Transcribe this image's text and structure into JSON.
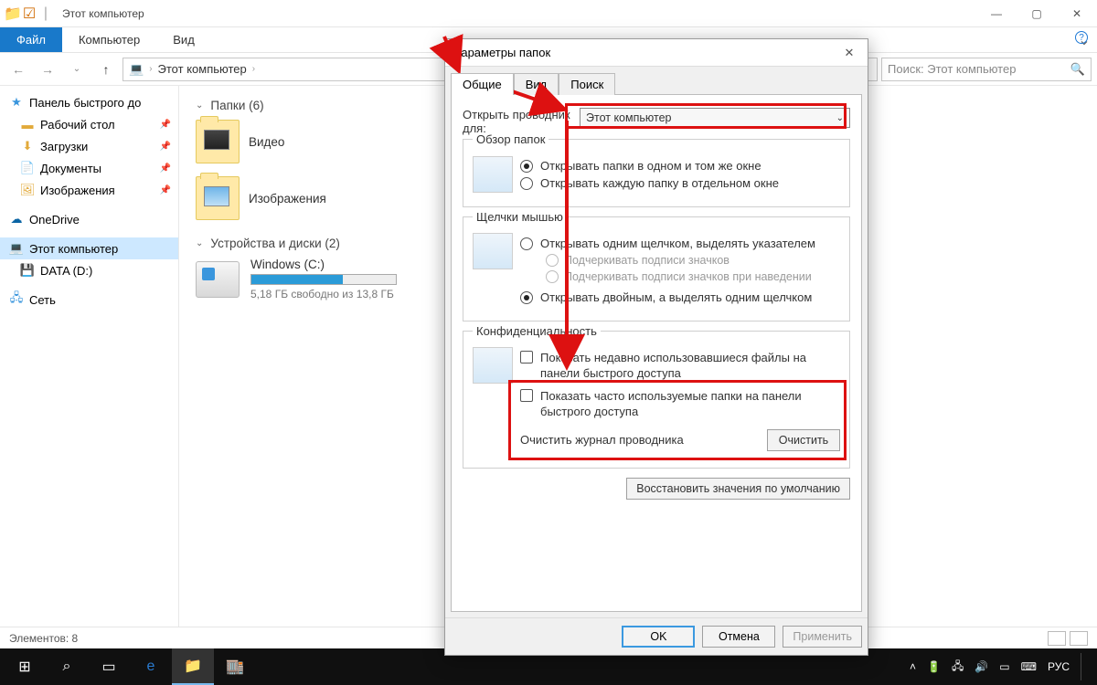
{
  "titlebar": {
    "title": "Этот компьютер"
  },
  "ribbon": {
    "file": "Файл",
    "tab_computer": "Компьютер",
    "tab_view": "Вид"
  },
  "address": {
    "root_icon": "💻",
    "crumb1": "Этот компьютер",
    "search_placeholder": "Поиск: Этот компьютер"
  },
  "sidebar": {
    "quick": "Панель быстрого до",
    "desktop": "Рабочий стол",
    "downloads": "Загрузки",
    "documents": "Документы",
    "pictures": "Изображения",
    "onedrive": "OneDrive",
    "thispc": "Этот компьютер",
    "data": "DATA (D:)",
    "network": "Сеть"
  },
  "content": {
    "folders_header": "Папки (6)",
    "video": "Видео",
    "images": "Изображения",
    "drives_header": "Устройства и диски (2)",
    "drive_c_name": "Windows (C:)",
    "drive_c_sub": "5,18 ГБ свободно из 13,8 ГБ"
  },
  "status": {
    "items": "Элементов: 8"
  },
  "dialog": {
    "title": "Параметры папок",
    "tab_general": "Общие",
    "tab_view": "Вид",
    "tab_search": "Поиск",
    "open_for_label": "Открыть проводник для:",
    "open_for_value": "Этот компьютер",
    "browse_legend": "Обзор папок",
    "browse_opt1": "Открывать папки в одном и том же окне",
    "browse_opt2": "Открывать каждую папку в отдельном окне",
    "click_legend": "Щелчки мышью",
    "click_opt1": "Открывать одним щелчком, выделять указателем",
    "click_sub1": "Подчеркивать подписи значков",
    "click_sub2": "Подчеркивать подписи значков при наведении",
    "click_opt2": "Открывать двойным, а выделять одним щелчком",
    "privacy_legend": "Конфиденциальность",
    "privacy_chk1": "Показать недавно использовавшиеся файлы на панели быстрого доступа",
    "privacy_chk2": "Показать часто используемые папки на панели быстрого доступа",
    "clear_label": "Очистить журнал проводника",
    "clear_btn": "Очистить",
    "restore": "Восстановить значения по умолчанию",
    "ok": "OK",
    "cancel": "Отмена",
    "apply": "Применить"
  },
  "taskbar": {
    "time": "",
    "lang": "РУС"
  }
}
